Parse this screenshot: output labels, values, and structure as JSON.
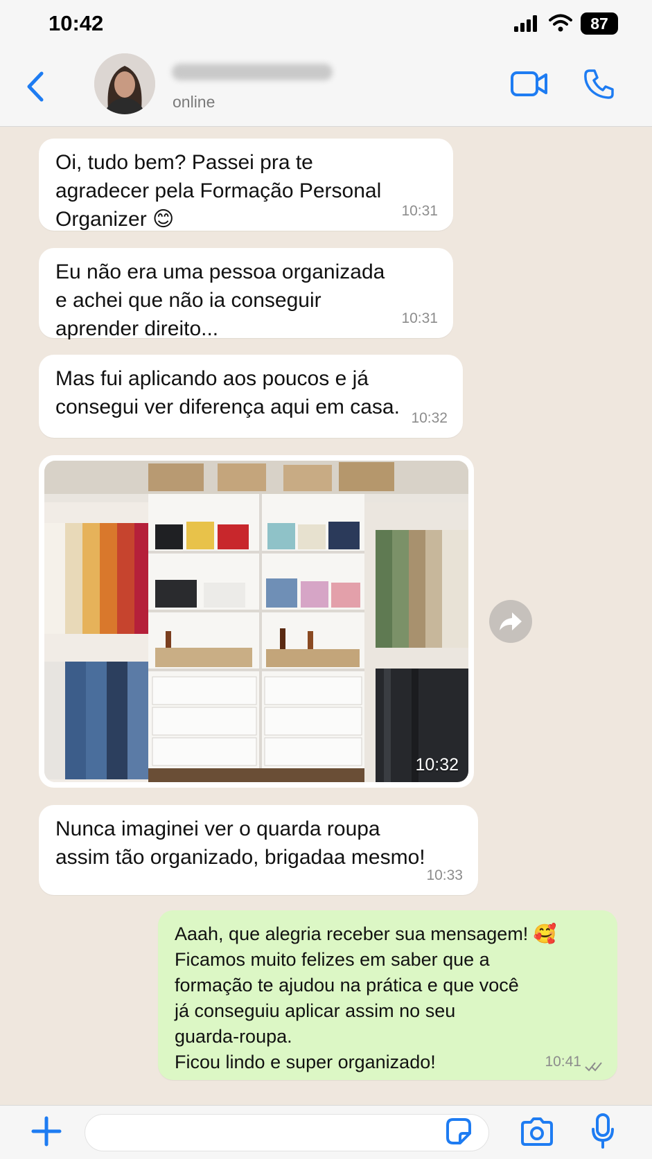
{
  "status_bar": {
    "time": "10:42",
    "battery": "87"
  },
  "header": {
    "contact_status": "online"
  },
  "messages": [
    {
      "text": "Oi, tudo bem? Passei pra te\nagradecer pela Formação Personal\nOrganizer 😊",
      "time": "10:31"
    },
    {
      "text": "Eu não era uma pessoa organizada\ne achei que não ia conseguir\naprender direito...",
      "time": "10:31"
    },
    {
      "text": "Mas fui aplicando aos poucos e já\nconsegui ver diferença aqui em casa.",
      "time": "10:32"
    },
    {
      "time": "10:32"
    },
    {
      "text": "Nunca imaginei ver o quarda roupa\nassim tão organizado, brigadaa mesmo!",
      "time": "10:33"
    },
    {
      "text": "Aaah, que alegria receber sua mensagem! 🥰\nFicamos muito felizes em saber que a\nformação te ajudou na prática e que você\njá conseguiu aplicar assim no seu\nguarda-roupa.\nFicou lindo e super organizado!",
      "time": "10:41"
    }
  ],
  "icons": {
    "back": "chevron-left-icon",
    "video": "video-camera-icon",
    "call": "phone-icon",
    "forward": "forward-arrow-icon",
    "attach": "plus-icon",
    "sticker": "sticker-icon",
    "camera": "camera-icon",
    "mic": "microphone-icon",
    "read_receipt": "double-check-icon"
  },
  "colors": {
    "accent": "#1e7cf2",
    "chat_background": "#efe7de",
    "incoming_bubble": "#ffffff",
    "outgoing_bubble": "#dcf7c5"
  }
}
